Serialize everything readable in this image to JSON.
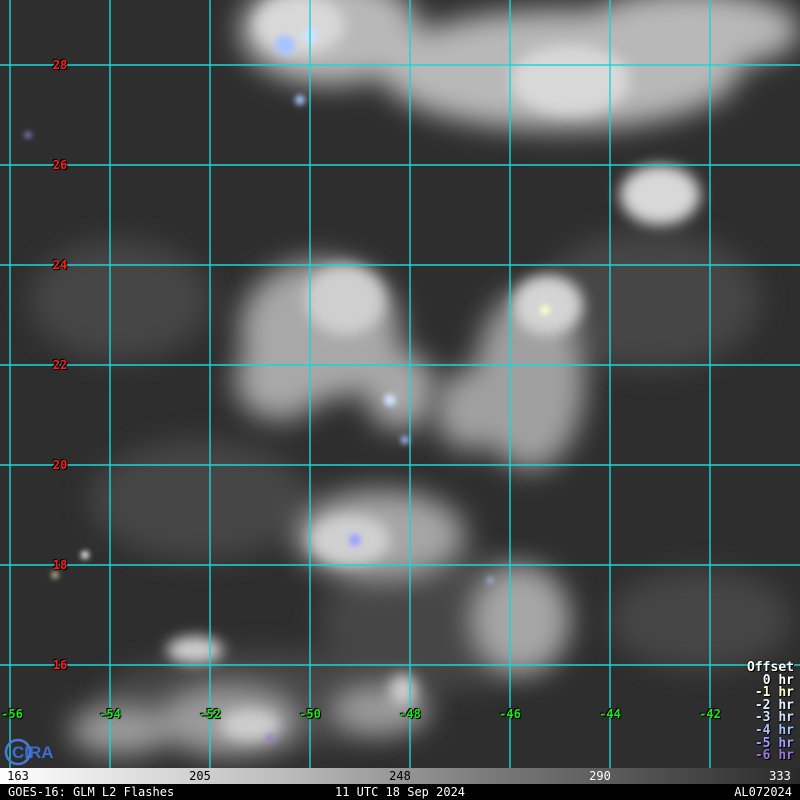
{
  "map": {
    "lat_labels": [
      "28",
      "26",
      "24",
      "22",
      "20",
      "18",
      "16"
    ],
    "lon_labels": [
      "-56",
      "-54",
      "-52",
      "-50",
      "-48",
      "-46",
      "-44",
      "-42"
    ]
  },
  "legend": {
    "title": "Offset",
    "entries": [
      {
        "label": "0 hr",
        "color": "#ffffff"
      },
      {
        "label": "-1 hr",
        "color": "#ffffcc"
      },
      {
        "label": "-2 hr",
        "color": "#e8f2ff"
      },
      {
        "label": "-3 hr",
        "color": "#cfe0ff"
      },
      {
        "label": "-4 hr",
        "color": "#a8c4ff"
      },
      {
        "label": "-5 hr",
        "color": "#9aa0ff"
      },
      {
        "label": "-6 hr",
        "color": "#9b79d6"
      }
    ]
  },
  "colorbar": {
    "ticks": [
      "163",
      "205",
      "248",
      "290",
      "333"
    ]
  },
  "footer": {
    "left": "GOES-16: GLM L2 Flashes",
    "center": "11 UTC 18 Sep 2024",
    "right": "AL072024"
  },
  "colors": {
    "grid": "#19d6d6",
    "lat_label": "#ff1c1c",
    "lon_label": "#1ee61e",
    "ocean": "#2e2e2e"
  },
  "logo": {
    "text": "CIRA"
  }
}
